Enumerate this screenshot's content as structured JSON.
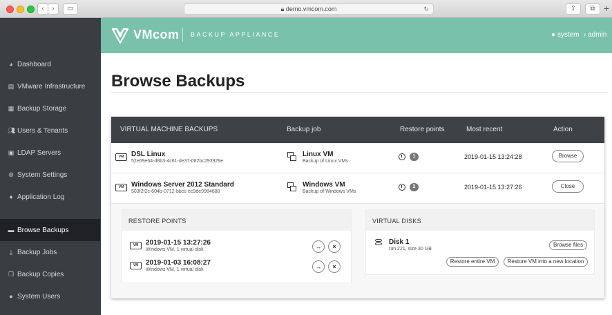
{
  "browser": {
    "url": "demo.vmcom.com"
  },
  "header": {
    "brand": "VMcom",
    "subbrand": "BACKUP APPLIANCE",
    "user_system": "system",
    "user_admin": "admin",
    "accent_color": "#79c1ab"
  },
  "sidebar": {
    "items": [
      {
        "label": "Dashboard",
        "icon": "dashboard-icon"
      },
      {
        "label": "VMware Infrastructure",
        "icon": "server-icon"
      },
      {
        "label": "Backup Storage",
        "icon": "storage-icon"
      },
      {
        "label": "Users & Tenants",
        "icon": "users-icon"
      },
      {
        "label": "LDAP Servers",
        "icon": "ldap-icon"
      },
      {
        "label": "System Settings",
        "icon": "gears-icon"
      },
      {
        "label": "Application Log",
        "icon": "log-icon"
      },
      {
        "label": "Browse Backups",
        "icon": "folder-icon",
        "active": true
      },
      {
        "label": "Backup Jobs",
        "icon": "download-icon"
      },
      {
        "label": "Backup Copies",
        "icon": "copy-icon"
      },
      {
        "label": "System Users",
        "icon": "user-icon"
      }
    ]
  },
  "main": {
    "title": "Browse Backups",
    "table": {
      "columns": [
        "VIRTUAL MACHINE BACKUPS",
        "Backup job",
        "Restore points",
        "Most recent",
        "Action"
      ],
      "rows": [
        {
          "vm_badge": "VM",
          "name": "DSL Linux",
          "id": "52e69e64-d8b3-4c61-de37-082bc293929e",
          "job": "Linux VM",
          "job_sub": "Backup of Linux VMs",
          "restore_points": "1",
          "most_recent": "2019-01-15 13:24:28",
          "action": "Browse"
        },
        {
          "vm_badge": "VM",
          "name": "Windows Server 2012 Standard",
          "id": "503f2f2c-604b-0712-bbcc-ec9de9984688",
          "job": "Windows VM",
          "job_sub": "Backup of Windows VMs",
          "restore_points": "2",
          "most_recent": "2019-01-15 13:27:26",
          "action": "Close"
        }
      ]
    },
    "restore_points": {
      "title": "RESTORE POINTS",
      "items": [
        {
          "badge": "VM",
          "date": "2019-01-15 13:27:26",
          "sub": "Windows VM, 1 virtual disk"
        },
        {
          "badge": "VM",
          "date": "2019-01-03 16:08:27",
          "sub": "Windows VM, 1 virtual disk"
        }
      ]
    },
    "virtual_disks": {
      "title": "VIRTUAL DISKS",
      "disk_name": "Disk 1",
      "disk_sub": "run 221, size 30 GB",
      "browse_files": "Browse files",
      "restore_entire": "Restore entire VM",
      "restore_new": "Restore VM into a new location"
    }
  }
}
